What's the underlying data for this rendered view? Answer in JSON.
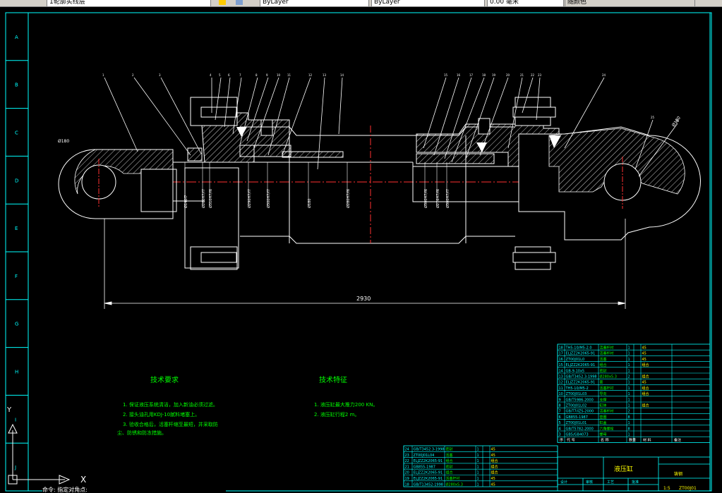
{
  "toolbar": {
    "layer_name": "1轮廓实线层",
    "linetype": "ByLayer",
    "lineweight_value": "ByLayer",
    "lineweight": "0.00 毫米",
    "plotstyle": "随颜色"
  },
  "border_letters": [
    "A",
    "B",
    "C",
    "D",
    "E",
    "F",
    "G",
    "H",
    "I",
    "J"
  ],
  "dimensions": {
    "overall_length": "2930",
    "left_hole": "Ø180",
    "right_hole": "Ø180",
    "shaft_dims": [
      "Ø140f7",
      "Ø260H7/f7",
      "Ø310H7/f6",
      "Ø290H7/f7",
      "Ø300H7/f7",
      "Ø180",
      "Ø280H7/f6",
      "Ø300H7/f6",
      "Ø276H7/f6",
      "Ø300H7/f7"
    ]
  },
  "callouts": [
    "1",
    "2",
    "3",
    "4",
    "5",
    "6",
    "7",
    "8",
    "9",
    "10",
    "11",
    "12",
    "13",
    "14",
    "15",
    "16",
    "17",
    "18",
    "19",
    "20",
    "21",
    "22",
    "23",
    "24",
    "25",
    "26",
    "27",
    "28",
    "29",
    "30"
  ],
  "tech_requirements": {
    "title": "技术要求",
    "items": [
      "1. 保证液压系统清洁，加入新油必须过滤。",
      "2. 接头油孔用KDJ-10腻料堵塞上。",
      "3. 验收合格后，活塞杆缩至最短，并采取防",
      "尘、防锈和防冻措施。"
    ]
  },
  "tech_features": {
    "title": "技术特征",
    "items": [
      "1. 液压缸最大推力200 KN。",
      "2. 液压缸行程2 m。"
    ]
  },
  "bom_upper": [
    [
      "18",
      "TH5-10/M5-2.0",
      "活塞杆衬",
      "1",
      "",
      "45",
      ""
    ],
    [
      "17",
      "ELJZZ2K2065-91",
      "活塞杆衬",
      "1",
      "",
      "45",
      ""
    ],
    [
      "16",
      "ZT00J01L0",
      "活塞",
      "1",
      "",
      "45",
      ""
    ],
    [
      "15",
      "ELJZZ2K2065-91",
      "组合",
      "1",
      "",
      "组合",
      ""
    ],
    [
      "14",
      "GB-9-10x5",
      "密封",
      "1",
      "",
      "",
      ""
    ],
    [
      "13",
      "GB/T3452.3-1998",
      "Ø280x5.3",
      "2",
      "",
      "组合",
      ""
    ],
    [
      "12",
      "ELJZZ2K2065-91",
      "套",
      "1",
      "",
      "45",
      ""
    ],
    [
      "11",
      "TH5-10/M5-2",
      "活塞杆衬",
      "1",
      "",
      "组合",
      ""
    ],
    [
      "10",
      "ZT00J01L03",
      "导向",
      "1",
      "",
      "组合",
      ""
    ],
    [
      "9",
      "GB/T5986-2000",
      "支撑",
      "1",
      "",
      "",
      ""
    ],
    [
      "8",
      "ZT00J01L02",
      "缸体",
      "1",
      "",
      "组合",
      ""
    ],
    [
      "7",
      "GB/T7/IZS-2000",
      "活塞杆衬",
      "2",
      "",
      "",
      ""
    ],
    [
      "6",
      "GB855-1987",
      "垫圈",
      "8",
      "",
      "",
      ""
    ],
    [
      "5",
      "ZT00J01L01",
      "缸盖",
      "1",
      "",
      "",
      ""
    ],
    [
      "4",
      "GB/T5782-2000",
      "六角螺栓",
      "8",
      "",
      "",
      ""
    ],
    [
      "3",
      "GB5/GB4073",
      "螺母",
      "1",
      "",
      "",
      ""
    ]
  ],
  "bom_upper_header": [
    "序",
    "代  号",
    "名  称",
    "数量",
    "",
    "材  料",
    "备注"
  ],
  "bom_lower": [
    [
      "24",
      "GB/T3452.3-1998",
      "密封",
      "1",
      "",
      "45"
    ],
    [
      "23",
      "ZT00J01L04",
      "活塞",
      "1",
      "",
      "45"
    ],
    [
      "22",
      "ELJZZ2K2065-91",
      "组合",
      "1",
      "",
      "组合"
    ],
    [
      "21",
      "GB855-1987",
      "密封",
      "1",
      "",
      "组合"
    ],
    [
      "20",
      "ELJZZ2K2065-91",
      "组合",
      "1",
      "",
      "组合"
    ],
    [
      "19",
      "ELJZZ2K2065-91",
      "活塞杆衬",
      "1",
      "",
      "45"
    ],
    [
      "18",
      "GB/T13452-1998",
      "Ø280x5.3",
      "1",
      "",
      "45"
    ]
  ],
  "title_block": {
    "part_name": "液压缸",
    "scale": "1:5",
    "material": "铸钢",
    "drawing_no": "ZT00J01",
    "labels": [
      "设计",
      "审核",
      "工艺",
      "批准"
    ]
  },
  "ucs": {
    "y_label": "Y",
    "x_label": "X"
  },
  "command_line": "命令: 指定对角点:"
}
